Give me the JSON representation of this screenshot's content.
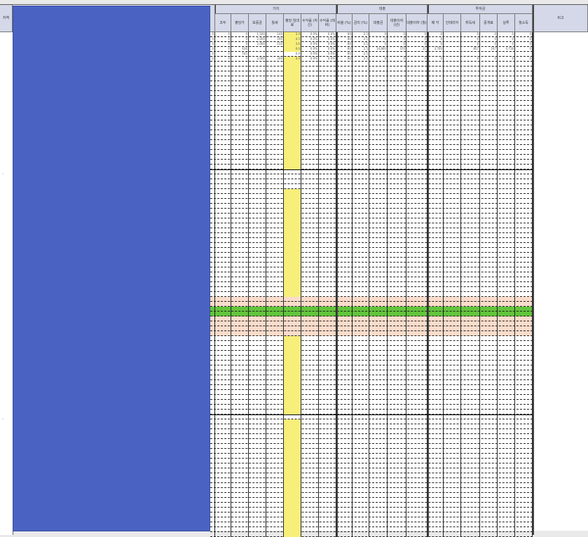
{
  "header": {
    "region_label": "지역",
    "groups": [
      {
        "label": "가치",
        "cols": [
          "조두",
          "평당가",
          "보증금",
          "월세",
          "평당 임대료",
          "수익률 (자신)",
          "수익률 (레버)"
        ]
      },
      {
        "label": "대출",
        "cols": [
          "비율 (%)",
          "금리 (%)",
          "대출금",
          "대출이자 (년)",
          "대출이자 (월)"
        ]
      },
      {
        "label": "투자금",
        "cols": [
          "매 각",
          "인테리어",
          "취득세",
          "중개료",
          "실투",
          "월소득"
        ]
      }
    ],
    "remark": "비고"
  },
  "rows": [
    [
      "0",
      "0",
      "0",
      "1,500",
      "140",
      "3.4",
      "0.0%",
      "0.0%",
      "80",
      "2.5",
      "0",
      "0",
      "0",
      "0",
      "",
      "0",
      "0",
      "0",
      "0"
    ],
    [
      "0",
      "0",
      "0",
      "2,000",
      "190",
      "4.5",
      "0.0%",
      "0.0%",
      "80",
      "2.5",
      "0",
      "0",
      "0",
      "0",
      "",
      "0",
      "0",
      "0",
      "0"
    ],
    [
      "0",
      "0",
      "0",
      "2,000",
      "150",
      "3.6",
      "0.0%",
      "0.0%",
      "80",
      "2.5",
      "0",
      "0",
      "0",
      "0",
      "",
      "0",
      "0",
      "0",
      "0"
    ],
    [
      "0",
      "0",
      "636",
      "",
      "",
      "0.0",
      "0.0%",
      "0.0%",
      "80",
      "2.5",
      "14,800",
      "370",
      "31",
      "3,700",
      "",
      "857",
      "167",
      "4,718",
      "0"
    ],
    [
      "0",
      "0",
      "545",
      "",
      "",
      "0.0",
      "0.0%",
      "0.0%",
      "80",
      "2.5",
      "",
      "",
      "",
      "",
      "",
      "",
      "",
      "",
      ""
    ],
    [
      "0",
      "0",
      "0",
      "2,000",
      "200",
      "4.4",
      "0.0%",
      "0.0%",
      "80",
      "2.5",
      "0",
      "0",
      "0",
      "0",
      "",
      "0",
      "0",
      "0",
      "0"
    ]
  ],
  "colors": {
    "header_bg": "#d4d8e8",
    "redaction": "#4a62c2",
    "highlight_yellow": "#f7ef7a",
    "highlight_orange": "#fbdccb",
    "selected_row_green": "#62c43c"
  }
}
